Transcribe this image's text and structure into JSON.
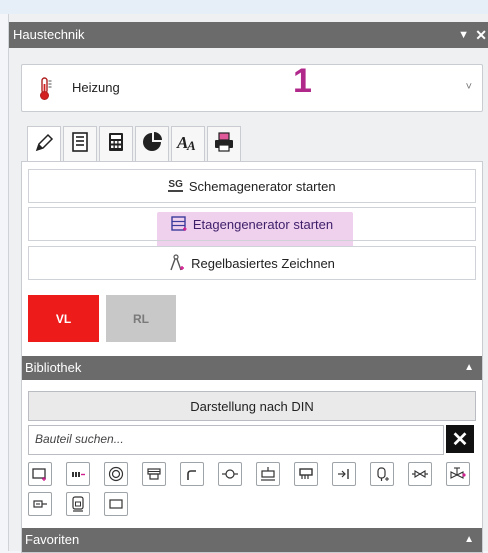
{
  "panel": {
    "title": "Haustechnik",
    "pin_glyph": "▼",
    "close_glyph": "✕"
  },
  "discipline": {
    "selected": "Heizung",
    "chevron": "˅",
    "icon": "thermometer-icon"
  },
  "annotation_marker": "1",
  "tabs": [
    {
      "icon": "pencil-icon",
      "active": true
    },
    {
      "icon": "list-icon",
      "active": false
    },
    {
      "icon": "calculator-icon",
      "active": false
    },
    {
      "icon": "pie-chart-icon",
      "active": false
    },
    {
      "icon": "text-style-icon",
      "active": false
    },
    {
      "icon": "printer-icon",
      "active": false
    }
  ],
  "actions": {
    "schema": {
      "icon_text": "SG",
      "label": "Schemagenerator starten"
    },
    "etage": {
      "label": "Etagengenerator starten"
    },
    "regel": {
      "label": "Regelbasiertes Zeichnen"
    }
  },
  "line_type": {
    "vl": "VL",
    "rl": "RL",
    "active": "VL",
    "active_color": "#ee1b1b"
  },
  "library": {
    "title": "Bibliothek",
    "collapse_glyph": "▲",
    "display_button": "Darstellung nach DIN",
    "search_placeholder": "Bauteil suchen...",
    "clear_glyph": "✕",
    "components": [
      "radiator-component-icon",
      "manifold-component-icon",
      "boiler-component-icon",
      "valve-box-component-icon",
      "pipe-bend-component-icon",
      "pump-component-icon",
      "tank-component-icon",
      "heat-exchanger-component-icon",
      "outlet-component-icon",
      "expansion-vessel-component-icon",
      "check-valve-component-icon",
      "mixing-valve-component-icon",
      "meter-component-icon",
      "storage-component-icon",
      "rectangle-component-icon"
    ]
  },
  "favorites": {
    "title": "Favoriten",
    "collapse_glyph": "▲"
  }
}
